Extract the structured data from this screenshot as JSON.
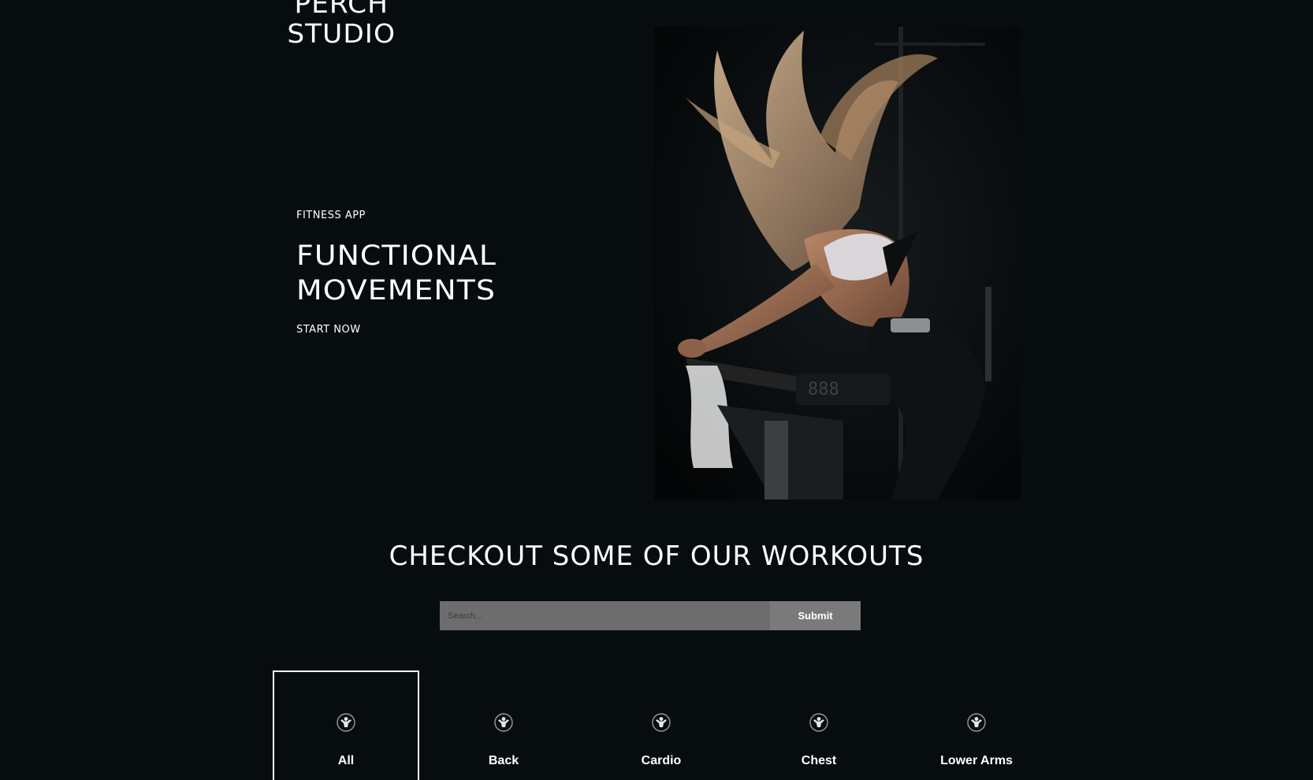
{
  "brand": {
    "logo_line1": "PERCH",
    "logo_line2": "STUDIO"
  },
  "hero": {
    "eyebrow": "FITNESS APP",
    "title_line1": "FUNCTIONAL",
    "title_line2": "MOVEMENTS",
    "cta_label": "START NOW"
  },
  "workouts": {
    "section_title": "CHECKOUT SOME OF OUR WORKOUTS",
    "search_placeholder": "Search...",
    "submit_label": "Submit",
    "selected_category": "All",
    "categories": [
      {
        "label": "All",
        "icon": "bodybuilder-icon"
      },
      {
        "label": "Back",
        "icon": "bodybuilder-icon"
      },
      {
        "label": "Cardio",
        "icon": "bodybuilder-icon"
      },
      {
        "label": "Chest",
        "icon": "bodybuilder-icon"
      },
      {
        "label": "Lower Arms",
        "icon": "bodybuilder-icon"
      }
    ]
  },
  "colors": {
    "background": "#070c0e",
    "text": "#ffffff",
    "search_bar": "#6d6d6d",
    "selected_border": "#ffffff"
  }
}
